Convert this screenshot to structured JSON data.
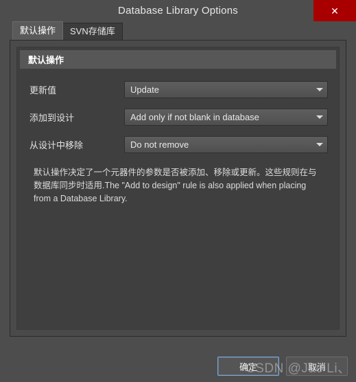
{
  "window": {
    "title": "Database Library Options",
    "close_icon": "close-icon",
    "close_label": "✕"
  },
  "tabs": [
    {
      "id": "default-operations",
      "label": "默认操作",
      "active": true
    },
    {
      "id": "svn-repository",
      "label": "SVN存储库",
      "active": false
    }
  ],
  "panel": {
    "group_title": "默认操作",
    "rows": [
      {
        "id": "update-values",
        "label": "更新值",
        "value": "Update",
        "arrow_icon": "chevron-down-icon"
      },
      {
        "id": "add-to-design",
        "label": "添加到设计",
        "value": "Add only if not blank in database",
        "arrow_icon": "chevron-down-icon"
      },
      {
        "id": "remove-from-design",
        "label": "从设计中移除",
        "value": "Do not remove",
        "arrow_icon": "chevron-down-icon"
      }
    ],
    "description": "默认操作决定了一个元器件的参数是否被添加、移除或更新。这些规则在与数据库同步时适用.The \"Add to design\" rule is also applied when placing from a Database Library."
  },
  "footer": {
    "ok_label": "确定",
    "cancel_label": "取消"
  },
  "overlay": {
    "watermark_text": "CSDN @Jac Li、"
  },
  "colors": {
    "dialog_background": "#4d4d4d",
    "panel_background": "#3f3f3f",
    "close_button": "#a80000",
    "accent_focus": "#7aa7d4",
    "text_primary": "#e8e8e8"
  }
}
